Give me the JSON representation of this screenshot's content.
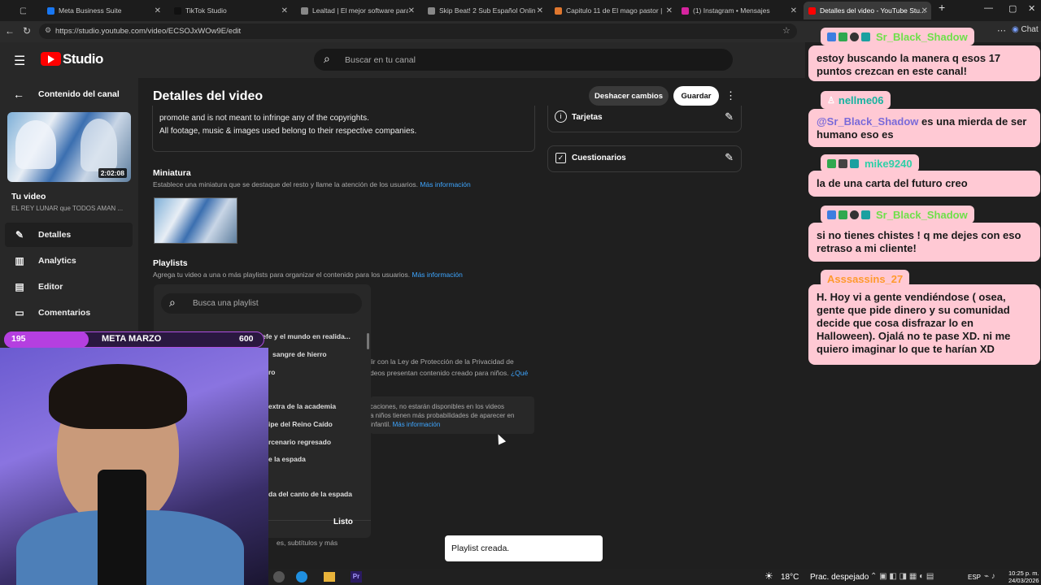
{
  "browser": {
    "tabs": [
      {
        "label": "Meta Business Suite",
        "color": "#1877f2"
      },
      {
        "label": "TikTok Studio",
        "color": "#111111"
      },
      {
        "label": "Lealtad | El mejor software para ...",
        "color": "#888888"
      },
      {
        "label": "Skip Beat! 2 Sub Español Online ...",
        "color": "#888888"
      },
      {
        "label": "Capitulo 11 de El mago pastor | ...",
        "color": "#e0772e"
      },
      {
        "label": "(1) Instagram • Mensajes",
        "color": "#d6249f"
      },
      {
        "label": "Detalles del video - YouTube Stu...",
        "color": "#ff0000"
      }
    ],
    "url": "https://studio.youtube.com/video/ECSOJxWOw9E/edit",
    "chat_button": "Chat"
  },
  "studio": {
    "logo": "Studio",
    "search_placeholder": "Buscar en tu canal",
    "sidebar": {
      "back_label": "Contenido del canal",
      "duration": "2:02:08",
      "your_video": "Tu video",
      "video_title": "EL REY LUNAR que TODOS AMAN ...",
      "items": [
        {
          "label": "Detalles",
          "icon": "pencil-icon"
        },
        {
          "label": "Analytics",
          "icon": "analytics-icon"
        },
        {
          "label": "Editor",
          "icon": "editor-icon"
        },
        {
          "label": "Comentarios",
          "icon": "comments-icon"
        }
      ]
    },
    "header": {
      "title": "Detalles del video",
      "undo": "Deshacer cambios",
      "save": "Guardar"
    },
    "description": {
      "line1": "promote and is not meant to infringe any of the copyrights.",
      "line2": "All footage, music & images used belong to their respective companies."
    },
    "thumbnail": {
      "title": "Miniatura",
      "desc": "Establece una miniatura que se destaque del resto y llame la atención de los usuarios.",
      "link": "Más información"
    },
    "playlists": {
      "title": "Playlists",
      "desc": "Agrega tu video a una o más playlists para organizar el contenido para los usuarios.",
      "link": "Más información",
      "search_placeholder": "Busca una playlist",
      "items": [
        "Me parezco demasiado al jefe y el mundo en realida...",
        "sangre de hierro",
        "ro",
        "extra de la academia",
        "ipe del Reino Caído",
        "rcenario regresado",
        "e la espada",
        "da del canto de la espada"
      ],
      "done": "Listo"
    },
    "audience": {
      "line1": "lir con la Ley de Protección de la Privacidad de",
      "line2": "deos presentan contenido creado para niños.",
      "link": "¿Qué",
      "note1": "caciones, no estarán disponibles en los videos",
      "note2": "a niños tienen más probabilidades de aparecer en",
      "note3": "infantil.",
      "note_link": "Más información"
    },
    "more": "es, subtítulos y más",
    "right_cards": [
      {
        "label": "Tarjetas",
        "icon": "info-icon"
      },
      {
        "label": "Cuestionarios",
        "icon": "checkbox-icon"
      }
    ],
    "toast": "Playlist creada."
  },
  "overlay": {
    "meta_left": "195",
    "meta_label": "META MARZO",
    "meta_right": "600"
  },
  "chat": {
    "messages": [
      {
        "user": "Sr_Black_Shadow",
        "text": "estoy buscando la manera q esos 17 puntos crezcan en este canal!"
      },
      {
        "user": "nellme06",
        "mention": "@Sr_Black_Shadow",
        "text": " es una mierda de ser humano eso es"
      },
      {
        "user": "mike9240",
        "text": "la de una carta del futuro creo"
      },
      {
        "user": "Sr_Black_Shadow",
        "text": "si no tienes chistes ! q me dejes con eso retraso a mi cliente!"
      },
      {
        "user": "Asssassins_27",
        "text": "H. Hoy vi a gente vendiéndose ( osea, gente que pide dinero y su comunidad decide que cosa disfrazar lo en Halloween). Ojalá no te pase XD. ni me quiero imaginar lo que te harían XD"
      }
    ]
  },
  "taskbar": {
    "weather": "18°C",
    "weather_desc": "Prac. despejado",
    "lang": "ESP",
    "time": "10:25 p. m.",
    "date": "24/03/2026"
  }
}
